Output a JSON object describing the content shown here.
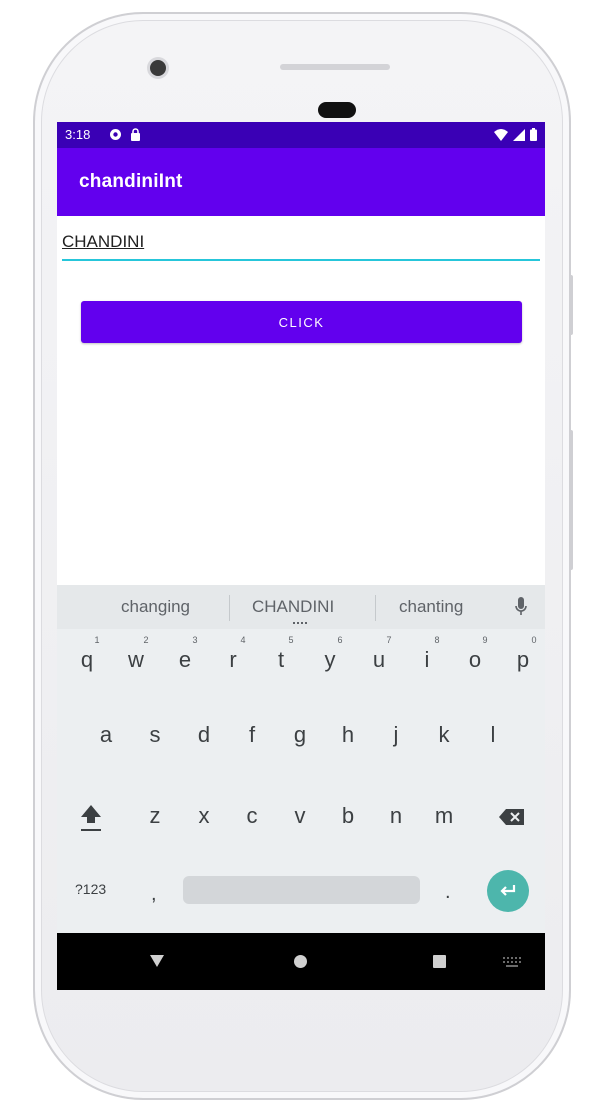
{
  "status_bar": {
    "time": "3:18",
    "left_icons": [
      "circle-status-icon",
      "lock-icon"
    ],
    "right_icons": [
      "wifi-icon",
      "signal-icon",
      "battery-icon"
    ]
  },
  "app_bar": {
    "title": "chandiniInt"
  },
  "edit_text": {
    "value": "CHANDINI"
  },
  "button": {
    "label": "CLICK"
  },
  "keyboard": {
    "suggestions": [
      "changing",
      "CHANDINI",
      "chanting"
    ],
    "row1": [
      "q",
      "w",
      "e",
      "r",
      "t",
      "y",
      "u",
      "i",
      "o",
      "p"
    ],
    "row1_hints": [
      "1",
      "2",
      "3",
      "4",
      "5",
      "6",
      "7",
      "8",
      "9",
      "0"
    ],
    "row2": [
      "a",
      "s",
      "d",
      "f",
      "g",
      "h",
      "j",
      "k",
      "l"
    ],
    "row3": [
      "z",
      "x",
      "c",
      "v",
      "b",
      "n",
      "m"
    ],
    "symbols_key": "?123",
    "comma_key": ",",
    "period_key": "."
  },
  "colors": {
    "status_bar": "#3a00b5",
    "primary": "#6200ee",
    "accent": "#26c6da",
    "enter_key": "#4db6ac"
  }
}
